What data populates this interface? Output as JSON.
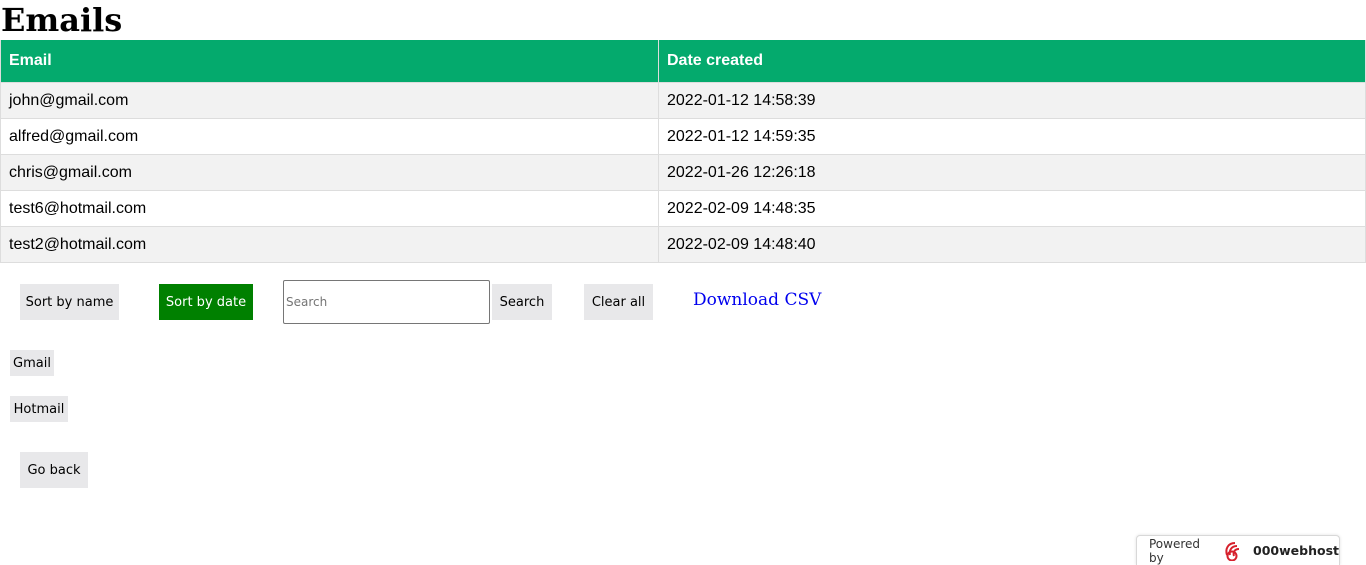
{
  "page": {
    "title": "Emails"
  },
  "table": {
    "headers": [
      "Email",
      "Date created"
    ],
    "rows": [
      {
        "email": "john@gmail.com",
        "date": "2022-01-12 14:58:39"
      },
      {
        "email": "alfred@gmail.com",
        "date": "2022-01-12 14:59:35"
      },
      {
        "email": "chris@gmail.com",
        "date": "2022-01-26 12:26:18"
      },
      {
        "email": "test6@hotmail.com",
        "date": "2022-02-09 14:48:35"
      },
      {
        "email": "test2@hotmail.com",
        "date": "2022-02-09 14:48:40"
      }
    ]
  },
  "controls": {
    "sort_name": "Sort by name",
    "sort_date": "Sort by date",
    "search_placeholder": "Search",
    "search_button": "Search",
    "clear_all": "Clear all",
    "download_csv": "Download CSV"
  },
  "filters": [
    "Gmail",
    "Hotmail"
  ],
  "go_back": "Go back",
  "footer": {
    "powered_by": "Powered by",
    "brand": "000webhost",
    "logo_icon": "000webhost-logo-icon"
  },
  "colors": {
    "header_green": "#04aa6d",
    "active_button": "#008000",
    "link": "#0000ee"
  }
}
